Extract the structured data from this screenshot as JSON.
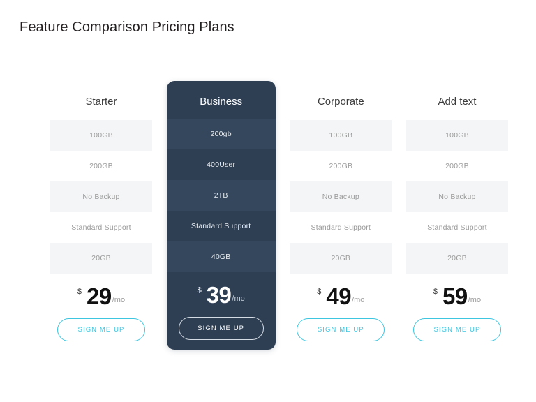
{
  "page": {
    "title": "Feature Comparison Pricing Plans",
    "background_color": "#ffffff",
    "accent_color": "#3ec6e0",
    "featured_card_color": "#2e3f54",
    "band_color": "#f4f5f6"
  },
  "pricing": {
    "currency_symbol": "$",
    "period_label": "/mo",
    "cta_label": "SIGN ME UP",
    "plans": [
      {
        "name": "Starter",
        "featured": false,
        "features": [
          "100GB",
          "200GB",
          "No Backup",
          "Standard Support",
          "20GB"
        ],
        "price": "29"
      },
      {
        "name": "Business",
        "featured": true,
        "features": [
          "200gb",
          "400User",
          "2TB",
          "Standard Support",
          "40GB"
        ],
        "price": "39"
      },
      {
        "name": "Corporate",
        "featured": false,
        "features": [
          "100GB",
          "200GB",
          "No Backup",
          "Standard Support",
          "20GB"
        ],
        "price": "49"
      },
      {
        "name": "Add text",
        "featured": false,
        "features": [
          "100GB",
          "200GB",
          "No Backup",
          "Standard Support",
          "20GB"
        ],
        "price": "59"
      }
    ]
  }
}
